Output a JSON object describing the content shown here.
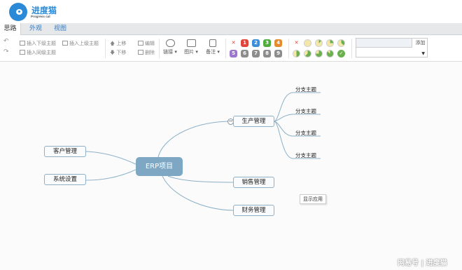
{
  "app": {
    "name": "进度猫",
    "subtitle": "Progress cat"
  },
  "tabs": [
    {
      "label": "思路",
      "active": true
    },
    {
      "label": "外观",
      "active": false
    },
    {
      "label": "视图",
      "active": false
    }
  ],
  "toolbar": {
    "insert_child": "插入下级主题",
    "insert_parent": "插入上级主题",
    "insert_sibling": "插入同级主题",
    "move_up": "上移",
    "move_down": "下移",
    "edit": "编辑",
    "delete": "删除",
    "link": "链接",
    "image": "图片",
    "note": "备注",
    "priority": [
      "1",
      "2",
      "3",
      "4",
      "5",
      "6",
      "7",
      "8",
      "9"
    ],
    "priority_colors": [
      "#e0443a",
      "#3d8ed8",
      "#4fad3c",
      "#e68a2e",
      "#9c77cf",
      "#8d8d8d",
      "#8d8d8d",
      "#8d8d8d",
      "#8d8d8d"
    ],
    "progress_levels": [
      0,
      0.125,
      0.25,
      0.375,
      0.5,
      0.625,
      0.75,
      0.875,
      1
    ],
    "resource_add": "添加",
    "resource_input": "",
    "resource_select": ""
  },
  "mindmap": {
    "root": "ERP项目",
    "left_nodes": [
      "客户管理",
      "系统设置"
    ],
    "right_nodes": [
      "生产管理",
      "销售管理",
      "财务管理"
    ],
    "branch_leaves": [
      "分支主题",
      "分支主题",
      "分支主题",
      "分支主题"
    ],
    "collapse_symbol": "−"
  },
  "tooltip": "显示应用",
  "watermark": "网易号 | 进度猫"
}
